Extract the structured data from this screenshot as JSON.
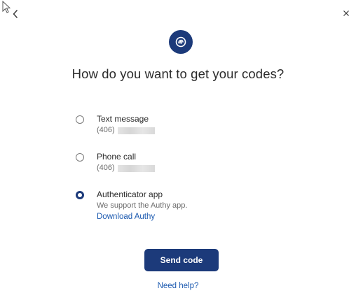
{
  "header": {
    "back_icon": "chevron-left-icon",
    "close_icon": "close-icon",
    "logo_icon": "authy-logo-icon"
  },
  "title": "How do you want to get your codes?",
  "options": [
    {
      "label": "Text message",
      "sub": "(406)",
      "selected": false
    },
    {
      "label": "Phone call",
      "sub": "(406)",
      "selected": false
    },
    {
      "label": "Authenticator app",
      "sub": "We support the Authy app.",
      "link": "Download Authy",
      "selected": true
    }
  ],
  "actions": {
    "send_code": "Send code",
    "need_help": "Need help?"
  },
  "colors": {
    "primary": "#1c3a7a",
    "link": "#1c5ab0"
  }
}
